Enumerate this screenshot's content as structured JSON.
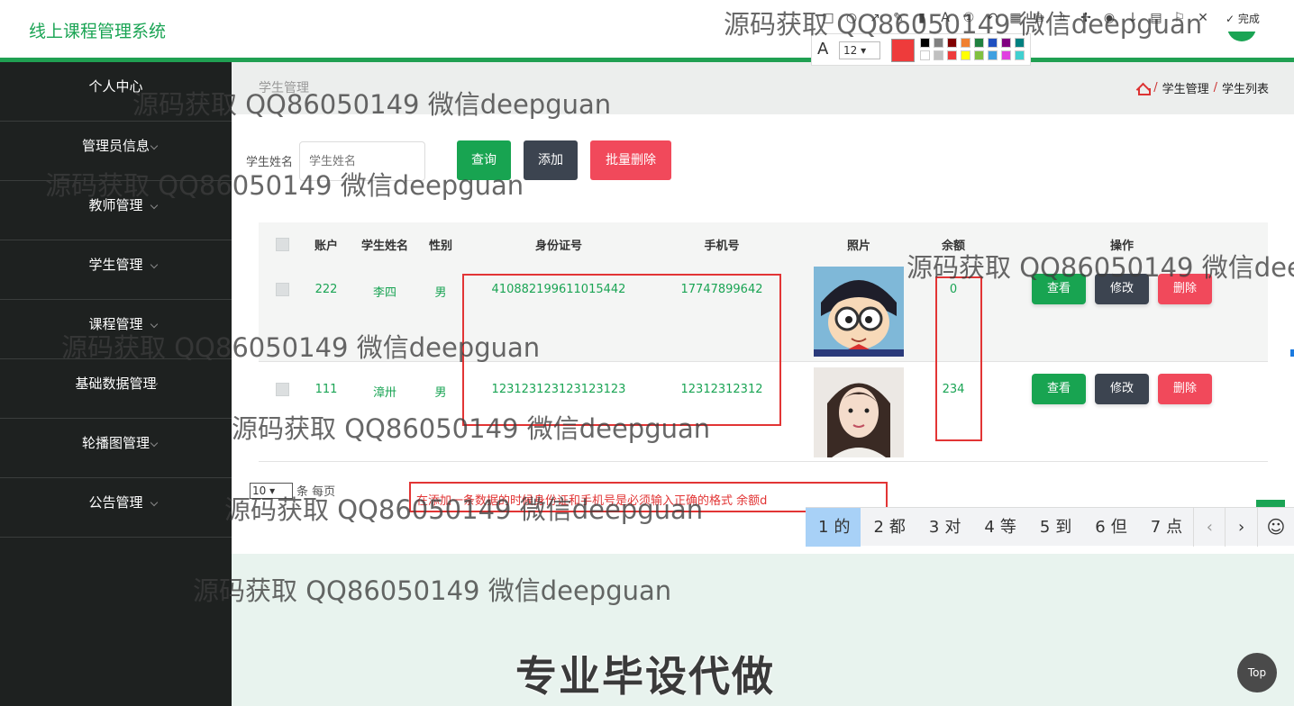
{
  "app": {
    "title": "线上课程管理系统"
  },
  "sidebar": {
    "items": [
      {
        "label": "个人中心"
      },
      {
        "label": "管理员信息"
      },
      {
        "label": "教师管理"
      },
      {
        "label": "学生管理"
      },
      {
        "label": "课程管理"
      },
      {
        "label": "基础数据管理"
      },
      {
        "label": "轮播图管理"
      },
      {
        "label": "公告管理"
      }
    ]
  },
  "page": {
    "name": "学生管理",
    "breadcrumb": [
      "学生管理",
      "学生列表"
    ],
    "breadcrumb_sep": "/"
  },
  "search": {
    "label": "学生姓名",
    "placeholder": "学生姓名",
    "query_label": "查询",
    "add_label": "添加",
    "batch_delete_label": "批量删除"
  },
  "table": {
    "headers": [
      "账户",
      "学生姓名",
      "性别",
      "身份证号",
      "手机号",
      "照片",
      "余额",
      "操作"
    ],
    "rows": [
      {
        "account": "222",
        "name": "李四",
        "gender": "男",
        "id_number": "410882199611015442",
        "phone": "17747899642",
        "balance": "0"
      },
      {
        "account": "111",
        "name": "漳卅",
        "gender": "男",
        "id_number": "123123123123123123",
        "phone": "12312312312",
        "balance": "234"
      }
    ],
    "actions": {
      "view": "查看",
      "edit": "修改",
      "delete": "删除"
    }
  },
  "pagination": {
    "page_size": "10",
    "page_size_suffix": "条 每页"
  },
  "annotation": {
    "text": "在添加一条数据的时候身份证和手机号是必须输入正确的格式 余额d"
  },
  "ime": {
    "candidates": [
      {
        "num": "1",
        "text": "的"
      },
      {
        "num": "2",
        "text": "都"
      },
      {
        "num": "3",
        "text": "对"
      },
      {
        "num": "4",
        "text": "等"
      },
      {
        "num": "5",
        "text": "到"
      },
      {
        "num": "6",
        "text": "但"
      },
      {
        "num": "7",
        "text": "点"
      }
    ],
    "prev": "‹",
    "next": "›",
    "emoji": "☺"
  },
  "snap_toolbar": {
    "font_size": "12",
    "done_label": "完成",
    "current_color": "#ee3b3b",
    "palette": [
      "#000000",
      "#808080",
      "#800000",
      "#f08030",
      "#208040",
      "#2050c0",
      "#800080",
      "#008080",
      "#ffffff",
      "#c0c0c0",
      "#ee3b3b",
      "#ffff00",
      "#80c040",
      "#40a0e0",
      "#e040e0",
      "#40d0d0"
    ]
  },
  "watermark": {
    "text": "源码获取 QQ86050149 微信deepguan",
    "banner": "专业毕设代做"
  },
  "top_button": "Top",
  "colors": {
    "brand_green": "#1aa454",
    "sidebar_bg": "#1e2120",
    "danger": "#f1495b",
    "dark_btn": "#3c4450",
    "annotation_red": "#e23535"
  }
}
